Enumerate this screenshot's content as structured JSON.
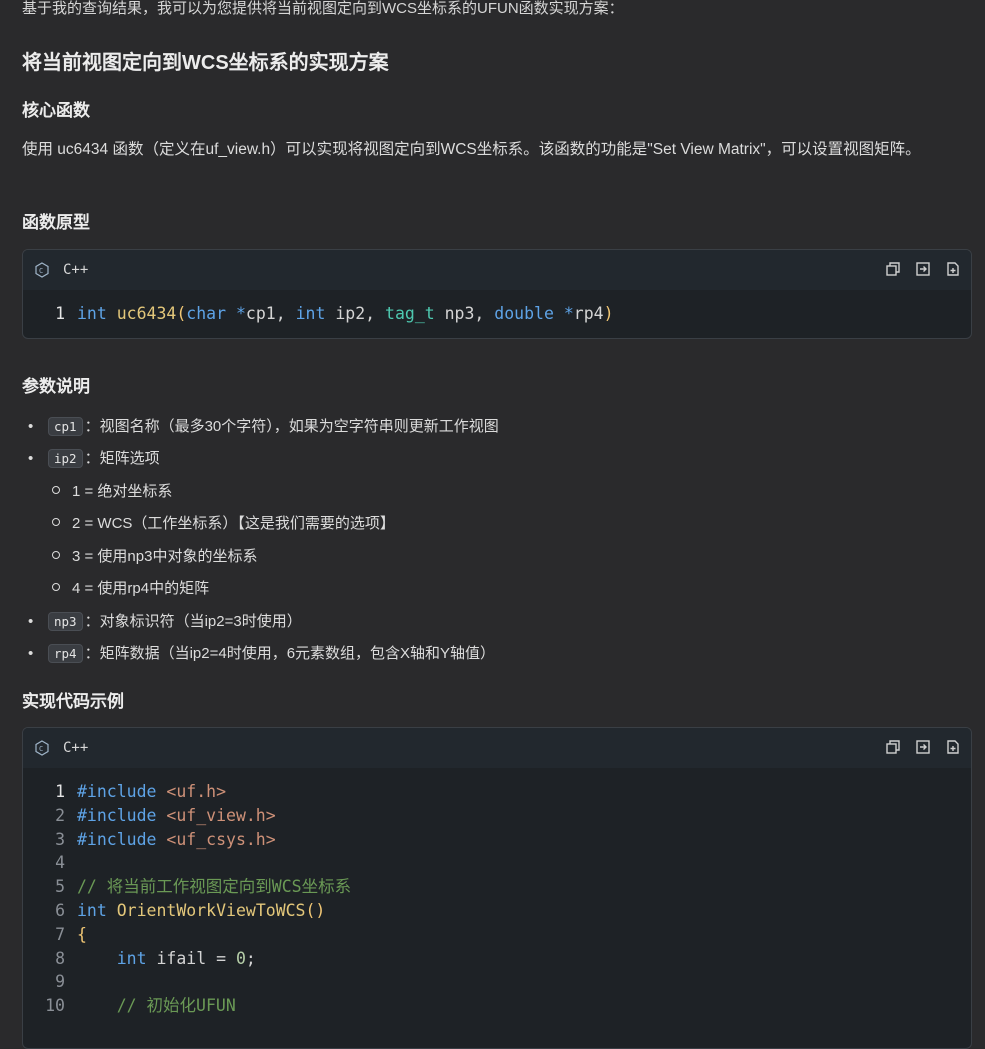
{
  "intro": "基于我的查询结果，我可以为您提供将当前视图定向到WCS坐标系的UFUN函数实现方案：",
  "title": "将当前视图定向到WCS坐标系的实现方案",
  "section_core": "核心函数",
  "core_para": "使用 uc6434 函数（定义在uf_view.h）可以实现将视图定向到WCS坐标系。该函数的功能是\"Set View Matrix\"，可以设置视图矩阵。",
  "section_proto": "函数原型",
  "code1": {
    "lang": "C++",
    "lines": [
      {
        "n": "1"
      }
    ],
    "tokens": {
      "int": "int",
      "fn": "uc6434",
      "lp": "(",
      "char": "char",
      "star1": " *",
      "cp1": "cp1, ",
      "int2": "int",
      "ip2": " ip2, ",
      "tag": "tag_t",
      "np3": " np3, ",
      "double": "double",
      "star2": " *",
      "rp4": "rp4",
      "rp": ")"
    }
  },
  "section_params": "参数说明",
  "params": {
    "cp1_tag": "cp1",
    "cp1_text": "：视图名称（最多30个字符），如果为空字符串则更新工作视图",
    "ip2_tag": "ip2",
    "ip2_text": "：矩阵选项",
    "opt1": "1 = 绝对坐标系",
    "opt2": "2 = WCS（工作坐标系）【这是我们需要的选项】",
    "opt3": "3 = 使用np3中对象的坐标系",
    "opt4": "4 = 使用rp4中的矩阵",
    "np3_tag": "np3",
    "np3_text": "：对象标识符（当ip2=3时使用）",
    "rp4_tag": "rp4",
    "rp4_text": "：矩阵数据（当ip2=4时使用，6元素数组，包含X轴和Y轴值）"
  },
  "section_example": "实现代码示例",
  "code2": {
    "lang": "C++",
    "l1": "#include ",
    "l1s": "<uf.h>",
    "l2": "#include ",
    "l2s": "<uf_view.h>",
    "l3": "#include ",
    "l3s": "<uf_csys.h>",
    "l5": "// 将当前工作视图定向到WCS坐标系",
    "l6k": "int",
    "l6f": "OrientWorkViewToWCS",
    "l6p": "()",
    "l7": "{",
    "l8k": "int",
    "l8i": " ifail = ",
    "l8n": "0",
    "l8e": ";",
    "l10": "// 初始化UFUN"
  },
  "bullet": "•",
  "colors": {
    "background": "#2a2a2c",
    "code_bg": "#1e2226",
    "keyword": "#5ea3e6",
    "function": "#e3c77a",
    "type": "#4ec9b0",
    "string": "#ce9178",
    "comment": "#6a9955"
  },
  "icons": [
    "cpp-language-icon",
    "copy-icon",
    "insert-icon",
    "new-file-icon"
  ]
}
